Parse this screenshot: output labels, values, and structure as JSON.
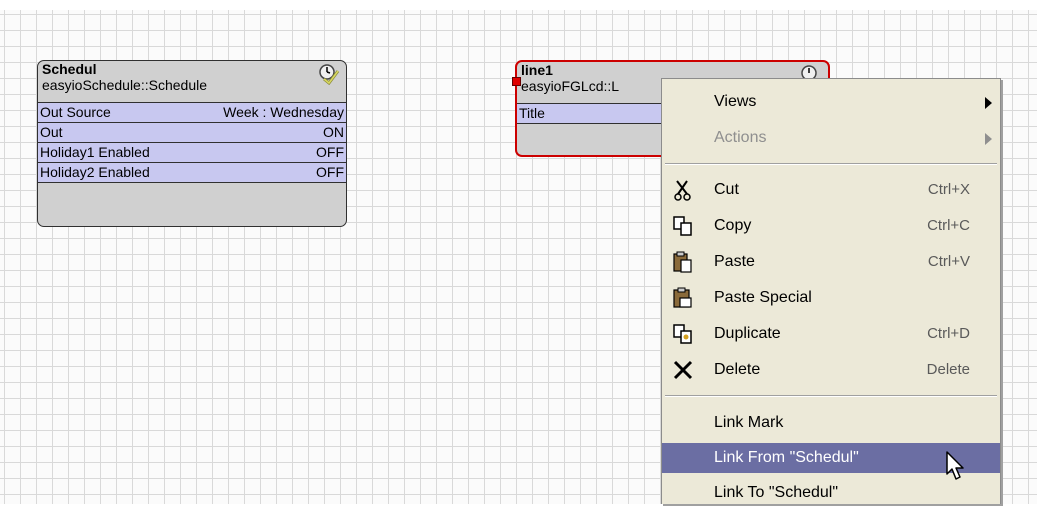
{
  "blocks": {
    "schedul": {
      "name": "Schedul",
      "type": "easyioSchedule::Schedule",
      "icon": "schedule-clock-icon",
      "rows": [
        {
          "label": "Out Source",
          "value": "Week : Wednesday"
        },
        {
          "label": "Out",
          "value": "ON"
        },
        {
          "label": "Holiday1 Enabled",
          "value": "OFF"
        },
        {
          "label": "Holiday2 Enabled",
          "value": "OFF"
        }
      ]
    },
    "line1": {
      "name": "line1",
      "type": "easyioFGLcd::L",
      "icon": "schedule-clock-icon",
      "rows": [
        {
          "label": "Title",
          "value": ""
        }
      ],
      "selection_color": "#cc0000"
    }
  },
  "context_menu": {
    "views": {
      "label": "Views",
      "icon": "submenu-arrow-icon"
    },
    "actions": {
      "label": "Actions",
      "icon": "submenu-arrow-icon"
    },
    "cut": {
      "label": "Cut",
      "shortcut": "Ctrl+X",
      "icon": "scissors-icon"
    },
    "copy": {
      "label": "Copy",
      "shortcut": "Ctrl+C",
      "icon": "copy-icon"
    },
    "paste": {
      "label": "Paste",
      "shortcut": "Ctrl+V",
      "icon": "paste-icon"
    },
    "paste_special": {
      "label": "Paste Special",
      "icon": "paste-special-icon"
    },
    "duplicate": {
      "label": "Duplicate",
      "shortcut": "Ctrl+D",
      "icon": "duplicate-icon"
    },
    "delete": {
      "label": "Delete",
      "shortcut": "Delete",
      "icon": "delete-x-icon"
    },
    "link_mark": {
      "label": "Link Mark"
    },
    "link_from": {
      "label": "Link From \"Schedul\""
    },
    "link_to": {
      "label": "Link To \"Schedul\""
    }
  },
  "colors": {
    "highlight": "#6b6ea3",
    "menu_bg": "#ece9d8",
    "slot_bg": "#c8c8f0"
  }
}
